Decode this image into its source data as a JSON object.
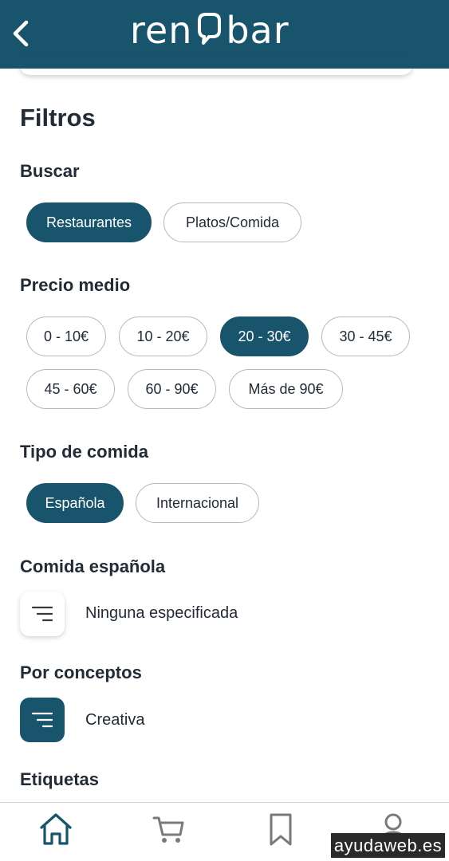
{
  "header": {
    "logo_left": "ren",
    "logo_right": "bar"
  },
  "page": {
    "title": "Filtros"
  },
  "buscar": {
    "title": "Buscar",
    "options": [
      {
        "label": "Restaurantes",
        "selected": true
      },
      {
        "label": "Platos/Comida",
        "selected": false
      }
    ]
  },
  "precio": {
    "title": "Precio medio",
    "options": [
      {
        "label": "0 - 10€",
        "selected": false
      },
      {
        "label": "10 - 20€",
        "selected": false
      },
      {
        "label": "20 - 30€",
        "selected": true
      },
      {
        "label": "30 - 45€",
        "selected": false
      },
      {
        "label": "45 - 60€",
        "selected": false
      },
      {
        "label": "60 - 90€",
        "selected": false
      },
      {
        "label": "Más de 90€",
        "selected": false
      }
    ]
  },
  "tipo": {
    "title": "Tipo de comida",
    "options": [
      {
        "label": "Española",
        "selected": true
      },
      {
        "label": "Internacional",
        "selected": false
      }
    ]
  },
  "comida_espanola": {
    "title": "Comida española",
    "value": "Ninguna especificada",
    "active": false
  },
  "conceptos": {
    "title": "Por conceptos",
    "value": "Creativa",
    "active": true
  },
  "etiquetas": {
    "title": "Etiquetas"
  },
  "nav": {
    "items": [
      {
        "icon": "home-icon",
        "active": true
      },
      {
        "icon": "cart-icon",
        "active": false
      },
      {
        "icon": "bookmark-icon",
        "active": false
      },
      {
        "icon": "profile-icon",
        "active": false
      }
    ]
  },
  "watermark": "ayudaweb.es",
  "colors": {
    "primary": "#18546c",
    "text": "#222b36",
    "muted": "#7a7a7a",
    "chip_border": "#b8b8b8"
  }
}
